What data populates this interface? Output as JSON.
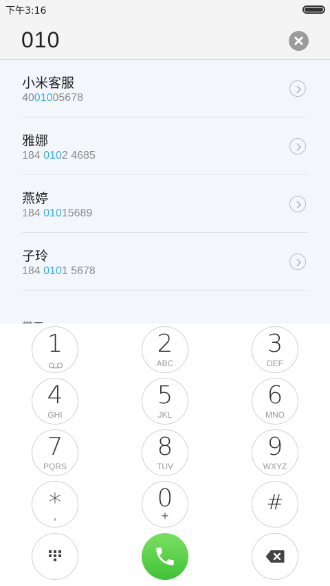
{
  "status_bar": {
    "time": "下午3:16"
  },
  "dialer": {
    "entered_number": "010"
  },
  "results": {
    "contacts": [
      {
        "name": "小米客服",
        "number_pre": "40",
        "number_match": "010",
        "number_post": "05678"
      },
      {
        "name": "雅娜",
        "number_pre": "184 ",
        "number_match": "010",
        "number_post": "2 4685"
      },
      {
        "name": "燕婷",
        "number_pre": "184 ",
        "number_match": "010",
        "number_post": "15689"
      },
      {
        "name": "子玲",
        "number_pre": "184 ",
        "number_match": "010",
        "number_post": "1 5678"
      }
    ],
    "next_partial": "带五"
  },
  "keypad": {
    "keys": [
      {
        "digit": "1",
        "letters": ""
      },
      {
        "digit": "2",
        "letters": "ABC"
      },
      {
        "digit": "3",
        "letters": "DEF"
      },
      {
        "digit": "4",
        "letters": "GHI"
      },
      {
        "digit": "5",
        "letters": "JKL"
      },
      {
        "digit": "6",
        "letters": "MNO"
      },
      {
        "digit": "7",
        "letters": "PQRS"
      },
      {
        "digit": "8",
        "letters": "TUV"
      },
      {
        "digit": "9",
        "letters": "WXYZ"
      },
      {
        "digit": "*",
        "letters": ","
      },
      {
        "digit": "0",
        "letters": "+"
      },
      {
        "digit": "#",
        "letters": ""
      }
    ]
  },
  "colors": {
    "match_highlight": "#3aaee4",
    "call_green": "#4cc93c",
    "list_bg": "#f3f7fc"
  },
  "icons": [
    "voicemail-icon",
    "grid-icon",
    "phone-icon",
    "backspace-icon",
    "clear-icon",
    "chevron-right-icon"
  ]
}
